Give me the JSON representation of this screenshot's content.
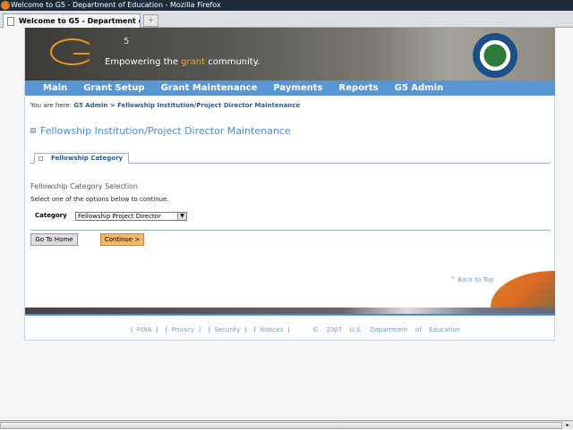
{
  "window": {
    "title": "Welcome to G5 - Department of Education - Mozilla Firefox",
    "tab": "Welcome to G5 - Department of Edu...",
    "new_tab": "+"
  },
  "header": {
    "logo_num": "5",
    "tagline_pre": "Empowering the ",
    "tagline_accent": "grant",
    "tagline_post": " community."
  },
  "nav": [
    "Main",
    "Grant Setup",
    "Grant Maintenance",
    "Payments",
    "Reports",
    "G5 Admin"
  ],
  "breadcrumb": {
    "prefix": "You are here: ",
    "path": "G5 Admin > Fellowship Institution/Project Director Maintenance"
  },
  "page_title": "Fellowship Institution/Project Director Maintenance",
  "tab_label": "Fellowship Category",
  "section": {
    "heading": "Fellowship Category Selection",
    "instruction": "Select one of the options below to continue.",
    "category_label": "Category",
    "category_value": "Fellowship Project Director"
  },
  "buttons": {
    "home": "Go To Home",
    "continue": "Continue >"
  },
  "back_to_top": "^ Back to Top",
  "footer": {
    "foia": "FOIA",
    "privacy": "Privacy",
    "security": "Security",
    "notices": "Notices",
    "copyright": "©  2007  U.S.  Department  of  Education"
  },
  "colors": {
    "nav": "#5a96d2",
    "accent": "#e8961e",
    "link": "#2a5aa0",
    "continue": "#f5b86a"
  }
}
